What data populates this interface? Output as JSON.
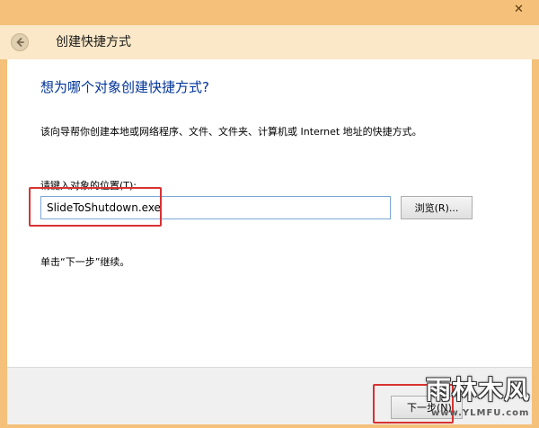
{
  "window": {
    "close_glyph": "✕"
  },
  "header": {
    "title": "创建快捷方式"
  },
  "main": {
    "question": "想为哪个对象创建快捷方式?",
    "description": "该向导帮你创建本地或网络程序、文件、文件夹、计算机或 Internet 地址的快捷方式。",
    "path_label": "请键入对象的位置(T):",
    "path_value": "SlideToShutdown.exe",
    "browse_label": "浏览(R)...",
    "continue_hint": "单击“下一步”继续。"
  },
  "footer": {
    "next_label": "下一步(N)"
  },
  "watermark": {
    "brand": "雨林木风",
    "url": "www.YLMFU.com"
  },
  "colors": {
    "accent_heading": "#003399",
    "highlight": "#d8322f",
    "window_frame": "#f4c07a"
  }
}
